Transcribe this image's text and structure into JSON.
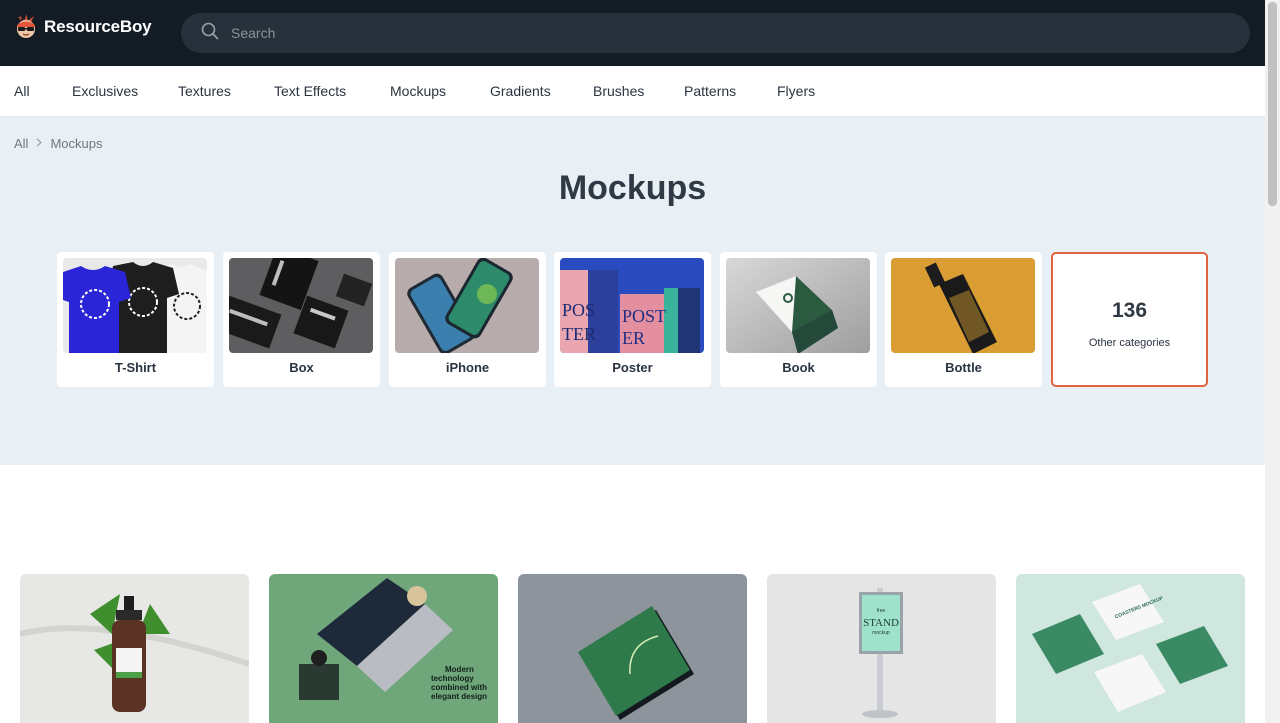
{
  "header": {
    "brand": "ResourceBoy",
    "search_placeholder": "Search"
  },
  "nav": {
    "items": [
      {
        "label": "All"
      },
      {
        "label": "Exclusives"
      },
      {
        "label": "Textures"
      },
      {
        "label": "Text Effects"
      },
      {
        "label": "Mockups"
      },
      {
        "label": "Gradients"
      },
      {
        "label": "Brushes"
      },
      {
        "label": "Patterns"
      },
      {
        "label": "Flyers"
      }
    ]
  },
  "breadcrumb": {
    "root": "All",
    "current": "Mockups"
  },
  "page": {
    "title": "Mockups"
  },
  "categories": [
    {
      "label": "T-Shirt"
    },
    {
      "label": "Box"
    },
    {
      "label": "iPhone"
    },
    {
      "label": "Poster"
    },
    {
      "label": "Book"
    },
    {
      "label": "Bottle"
    }
  ],
  "other_categories": {
    "count": "136",
    "label": "Other categories"
  },
  "results": {
    "laptop_tagline_l1": "Modern",
    "laptop_tagline_l2": "technology",
    "laptop_tagline_l3": "combined with",
    "laptop_tagline_l4": "elegant design",
    "stand_l1": "free",
    "stand_l2": "STAND",
    "stand_l3": "mockup",
    "coasters": "COASTERS MOCKUP"
  },
  "colors": {
    "header_bg": "#131c25",
    "search_bg": "#27313b",
    "hero_bg": "#e8eff5",
    "accent": "#e0623f"
  }
}
